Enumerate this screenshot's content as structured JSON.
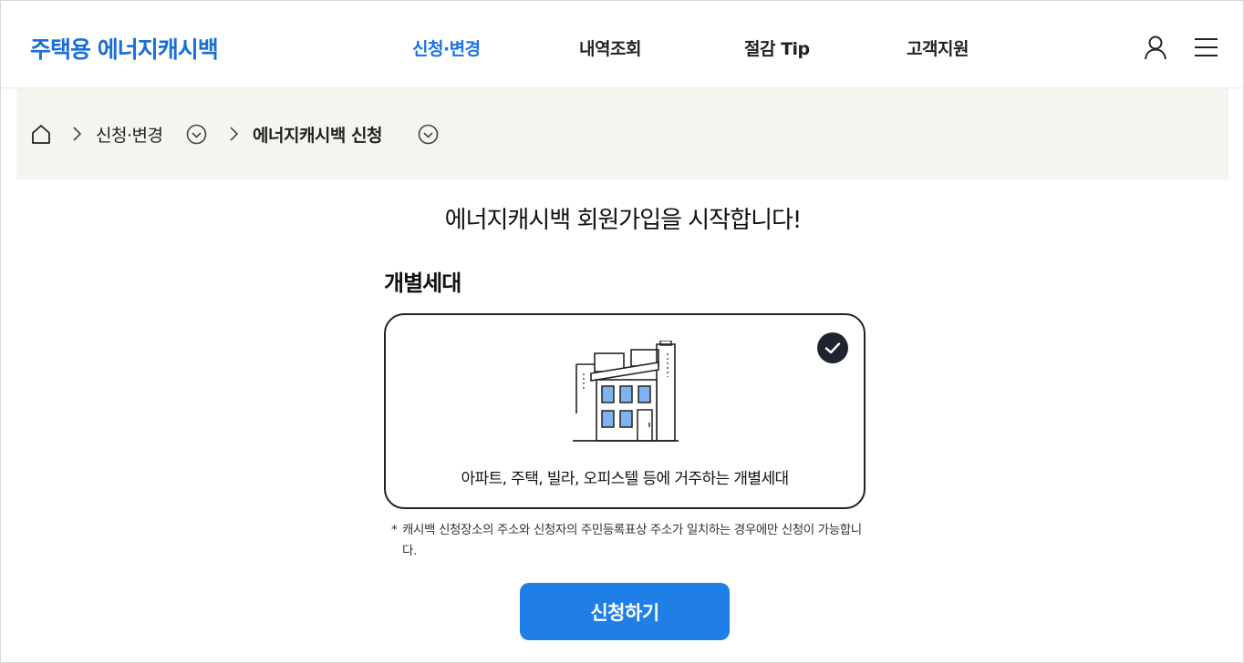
{
  "header": {
    "logo": "주택용 에너지캐시백",
    "nav": [
      {
        "label": "신청·변경",
        "active": true
      },
      {
        "label": "내역조회",
        "active": false
      },
      {
        "label": "절감 Tip",
        "active": false
      },
      {
        "label": "고객지원",
        "active": false
      }
    ],
    "icons": {
      "user": "user-icon",
      "menu": "hamburger-menu-icon"
    },
    "accent_color": "#1a73e8"
  },
  "breadcrumb": {
    "home_icon": "home-icon",
    "items": [
      {
        "label": "신청·변경"
      },
      {
        "label": "에너지캐시백 신청"
      }
    ],
    "background_color": "#f2f6ee"
  },
  "main": {
    "title": "에너지캐시백 회원가입을 시작합니다!",
    "section_title": "개별세대",
    "option_card": {
      "description": "아파트, 주택, 빌라, 오피스텔 등에 거주하는 개별세대",
      "selected": true,
      "icon": "building-icon"
    },
    "note_marker": "*",
    "note": "캐시백 신청장소의 주소와 신청자의 주민등록표상 주소가 일치하는 경우에만 신청이 가능합니다.",
    "apply_button": "신청하기",
    "button_color": "#1f7fe6"
  }
}
